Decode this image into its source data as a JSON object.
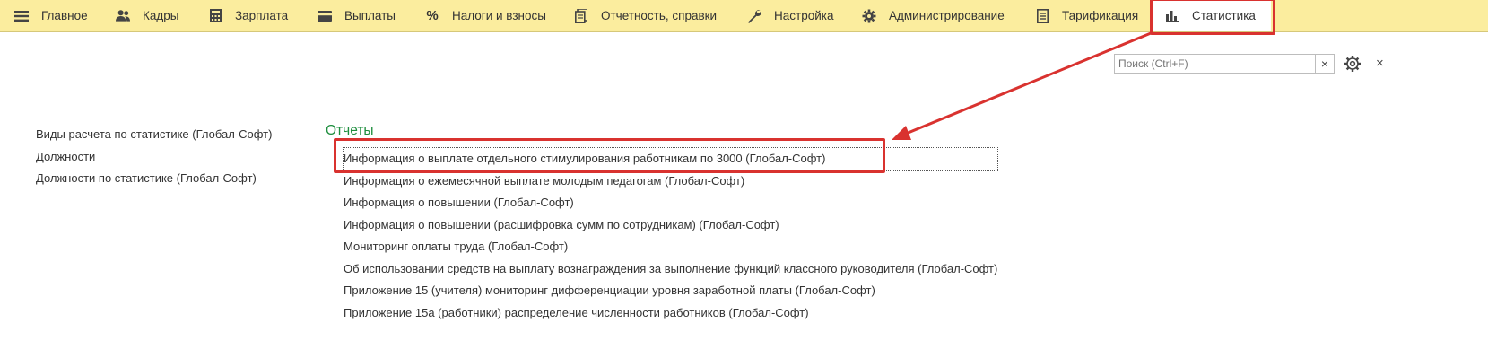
{
  "nav": {
    "tabs": [
      {
        "label": "Главное",
        "icon": "menu-icon"
      },
      {
        "label": "Кадры",
        "icon": "people-icon"
      },
      {
        "label": "Зарплата",
        "icon": "calculator-icon"
      },
      {
        "label": "Выплаты",
        "icon": "wallet-icon"
      },
      {
        "label": "Налоги и взносы",
        "icon": "percent-icon"
      },
      {
        "label": "Отчетность, справки",
        "icon": "documents-icon"
      },
      {
        "label": "Настройка",
        "icon": "wrench-icon"
      },
      {
        "label": "Администрирование",
        "icon": "gear-icon"
      },
      {
        "label": "Тарификация",
        "icon": "document-icon"
      },
      {
        "label": "Статистика",
        "icon": "bar-chart-icon"
      }
    ],
    "active_tab": "Статистика"
  },
  "search": {
    "placeholder": "Поиск (Ctrl+F)",
    "clear": "×"
  },
  "window": {
    "close": "×"
  },
  "left_links": [
    "Виды расчета по статистике (Глобал-Софт)",
    "Должности",
    "Должности по статистике (Глобал-Софт)"
  ],
  "reports": {
    "title": "Отчеты",
    "items": [
      "Информация о выплате отдельного стимулирования работникам по 3000 (Глобал-Софт)",
      "Информация о ежемесячной выплате молодым педагогам (Глобал-Софт)",
      "Информация о повышении  (Глобал-Софт)",
      "Информация о повышении (расшифровка сумм по сотрудникам) (Глобал-Софт)",
      "Мониторинг оплаты труда (Глобал-Софт)",
      "Об использовании средств на выплату вознаграждения за выполнение функций классного руководителя (Глобал-Софт)",
      "Приложение 15 (учителя) мониторинг дифференциации уровня заработной платы (Глобал-Софт)",
      "Приложение 15а (работники) распределение численности работников (Глобал-Софт)"
    ]
  },
  "colors": {
    "topbar": "#fbed9e",
    "annotation": "#d9322f",
    "section_title": "#1e8e3e"
  }
}
